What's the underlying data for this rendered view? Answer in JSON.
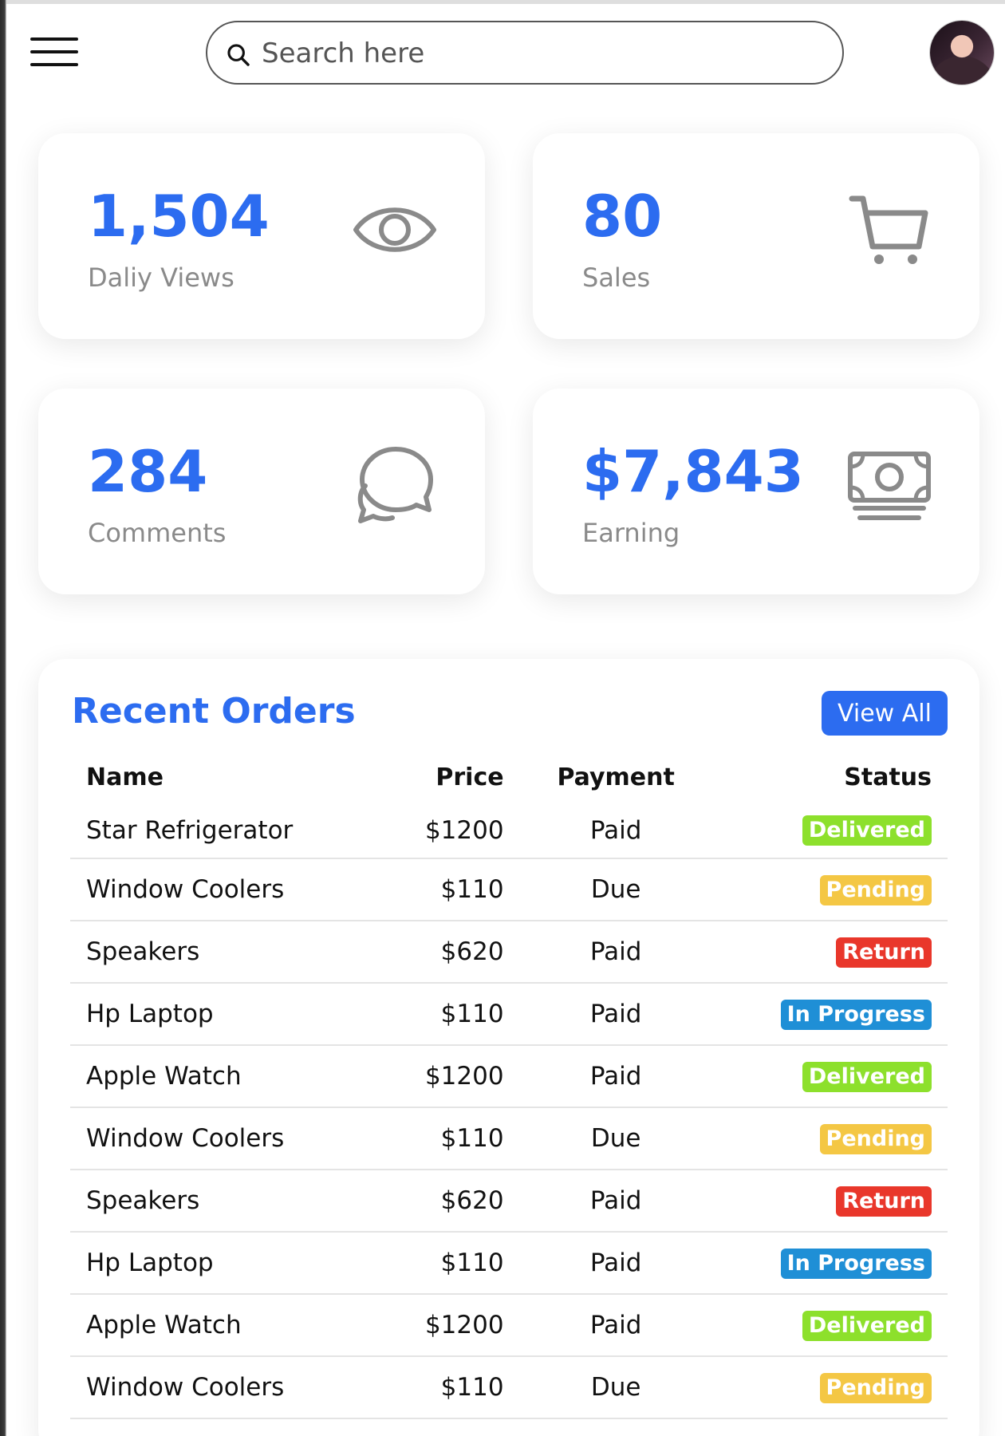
{
  "header": {
    "search_placeholder": "Search here"
  },
  "cards": [
    {
      "number": "1,504",
      "label": "Daliy Views",
      "icon": "eye-icon"
    },
    {
      "number": "80",
      "label": "Sales",
      "icon": "cart-icon"
    },
    {
      "number": "284",
      "label": "Comments",
      "icon": "chat-icon"
    },
    {
      "number": "$7,843",
      "label": "Earning",
      "icon": "cash-icon"
    }
  ],
  "orders": {
    "title": "Recent Orders",
    "view_all_label": "View All",
    "columns": {
      "name": "Name",
      "price": "Price",
      "payment": "Payment",
      "status": "Status"
    },
    "rows": [
      {
        "name": "Star Refrigerator",
        "price": "$1200",
        "payment": "Paid",
        "status": "Delivered",
        "status_type": "delivered"
      },
      {
        "name": "Window Coolers",
        "price": "$110",
        "payment": "Due",
        "status": "Pending",
        "status_type": "pending"
      },
      {
        "name": "Speakers",
        "price": "$620",
        "payment": "Paid",
        "status": "Return",
        "status_type": "return"
      },
      {
        "name": "Hp Laptop",
        "price": "$110",
        "payment": "Paid",
        "status": "In Progress",
        "status_type": "inprogress"
      },
      {
        "name": "Apple Watch",
        "price": "$1200",
        "payment": "Paid",
        "status": "Delivered",
        "status_type": "delivered"
      },
      {
        "name": "Window Coolers",
        "price": "$110",
        "payment": "Due",
        "status": "Pending",
        "status_type": "pending"
      },
      {
        "name": "Speakers",
        "price": "$620",
        "payment": "Paid",
        "status": "Return",
        "status_type": "return"
      },
      {
        "name": "Hp Laptop",
        "price": "$110",
        "payment": "Paid",
        "status": "In Progress",
        "status_type": "inprogress"
      },
      {
        "name": "Apple Watch",
        "price": "$1200",
        "payment": "Paid",
        "status": "Delivered",
        "status_type": "delivered"
      },
      {
        "name": "Window Coolers",
        "price": "$110",
        "payment": "Due",
        "status": "Pending",
        "status_type": "pending"
      }
    ]
  },
  "colors": {
    "accent": "#2c6cf0",
    "delivered": "#8de02c",
    "pending": "#f4c744",
    "return": "#e9372b",
    "in_progress": "#1f8fd6"
  }
}
